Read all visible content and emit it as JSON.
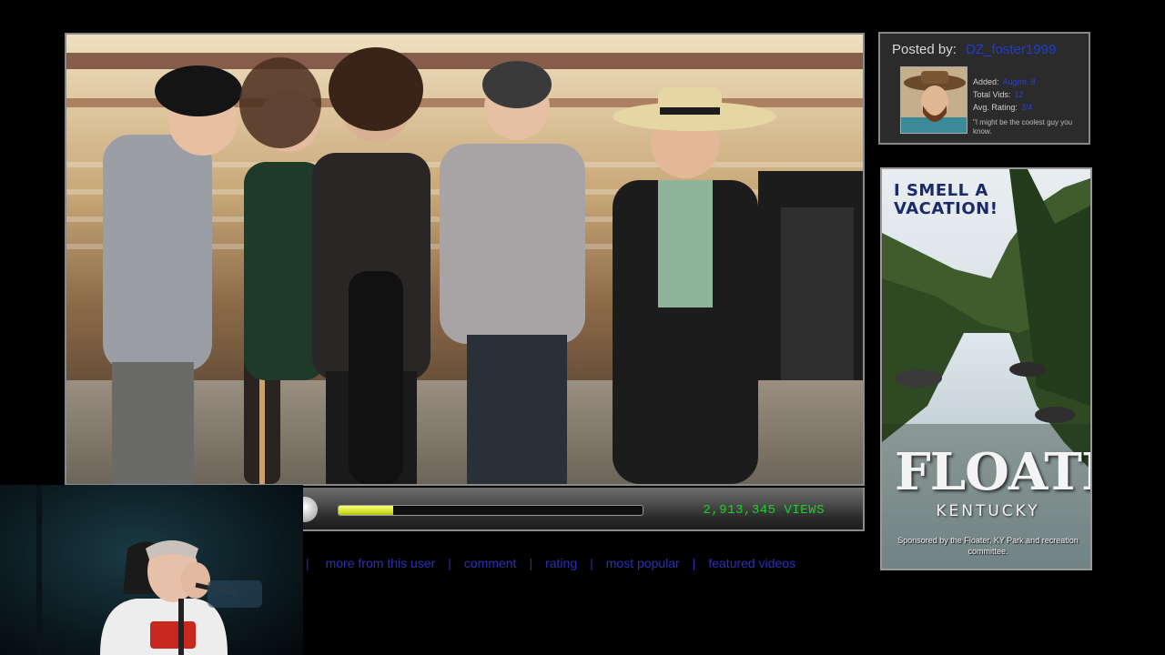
{
  "poster": {
    "label": "Posted by:",
    "username": "DZ_foster1999",
    "added_label": "Added:",
    "added_value": "Augmt. 8",
    "total_vids_label": "Total Vids:",
    "total_vids_value": "12",
    "avg_rating_label": "Avg. Rating:",
    "avg_rating_value": "3/4",
    "quote": "\"I might be the coolest guy you know."
  },
  "player": {
    "progress_fraction": 0.18,
    "view_count": "2,913,345 VIEWS"
  },
  "links": [
    "more from this user",
    "comment",
    "rating",
    "most popular",
    "featured videos"
  ],
  "ad": {
    "headline": "I SMELL A VACATION!",
    "title": "FLOATER",
    "subtitle": "KENTUCKY",
    "sponsor": "Sponsored by the Floater, KY Park and recreation committee."
  },
  "colors": {
    "progress": "#d6e430",
    "views": "#1fcf2a",
    "link": "#2a31b8"
  }
}
